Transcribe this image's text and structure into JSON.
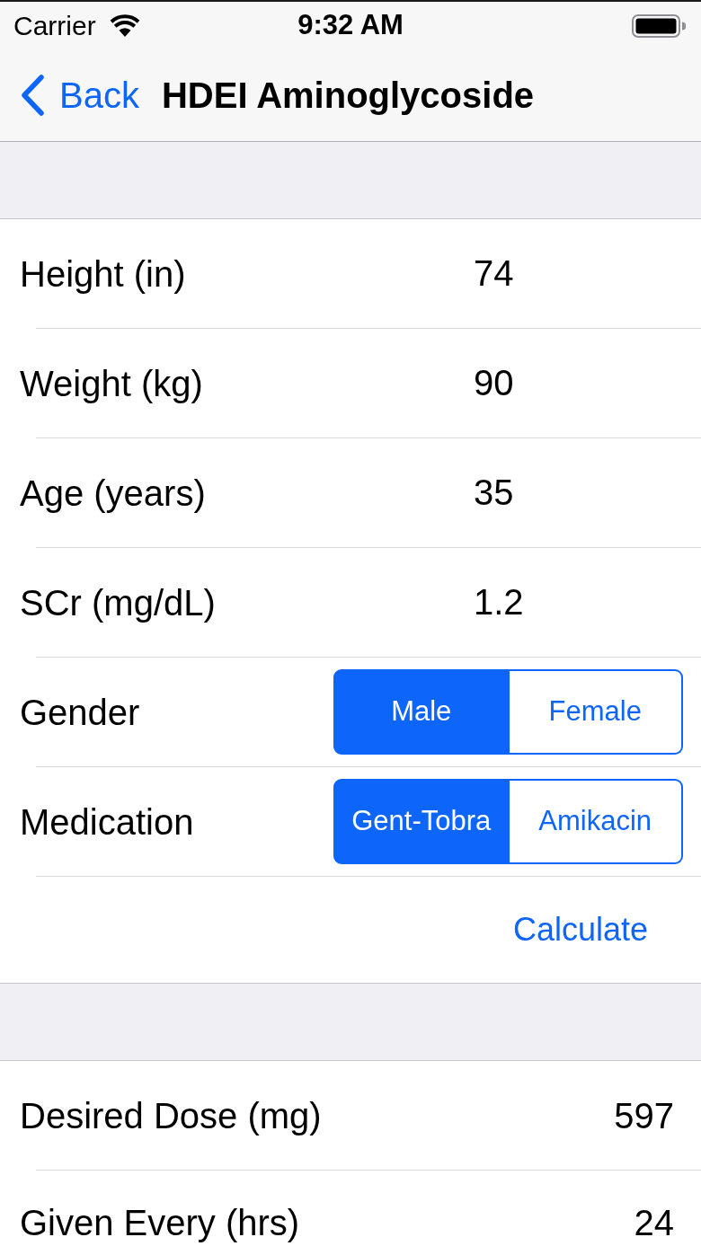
{
  "status_bar": {
    "carrier": "Carrier",
    "time": "9:32 AM"
  },
  "nav_bar": {
    "back": "Back",
    "title": "HDEI Aminoglycoside"
  },
  "inputs": [
    {
      "kind": "field",
      "label": "Height (in)",
      "value": "74"
    },
    {
      "kind": "field",
      "label": "Weight (kg)",
      "value": "90"
    },
    {
      "kind": "field",
      "label": "Age (years)",
      "value": "35"
    },
    {
      "kind": "field",
      "label": "SCr (mg/dL)",
      "value": "1.2"
    },
    {
      "kind": "segmented",
      "label": "Gender",
      "options": [
        {
          "label": "Male",
          "selected": true
        },
        {
          "label": "Female",
          "selected": false
        }
      ]
    },
    {
      "kind": "segmented",
      "label": "Medication",
      "options": [
        {
          "label": "Gent-Tobra",
          "selected": true
        },
        {
          "label": "Amikacin",
          "selected": false
        }
      ]
    }
  ],
  "calculate_button": {
    "label": "Calculate"
  },
  "results": [
    {
      "label": "Desired Dose (mg)",
      "value": "597"
    },
    {
      "label": "Given Every (hrs)",
      "value": "24"
    }
  ]
}
